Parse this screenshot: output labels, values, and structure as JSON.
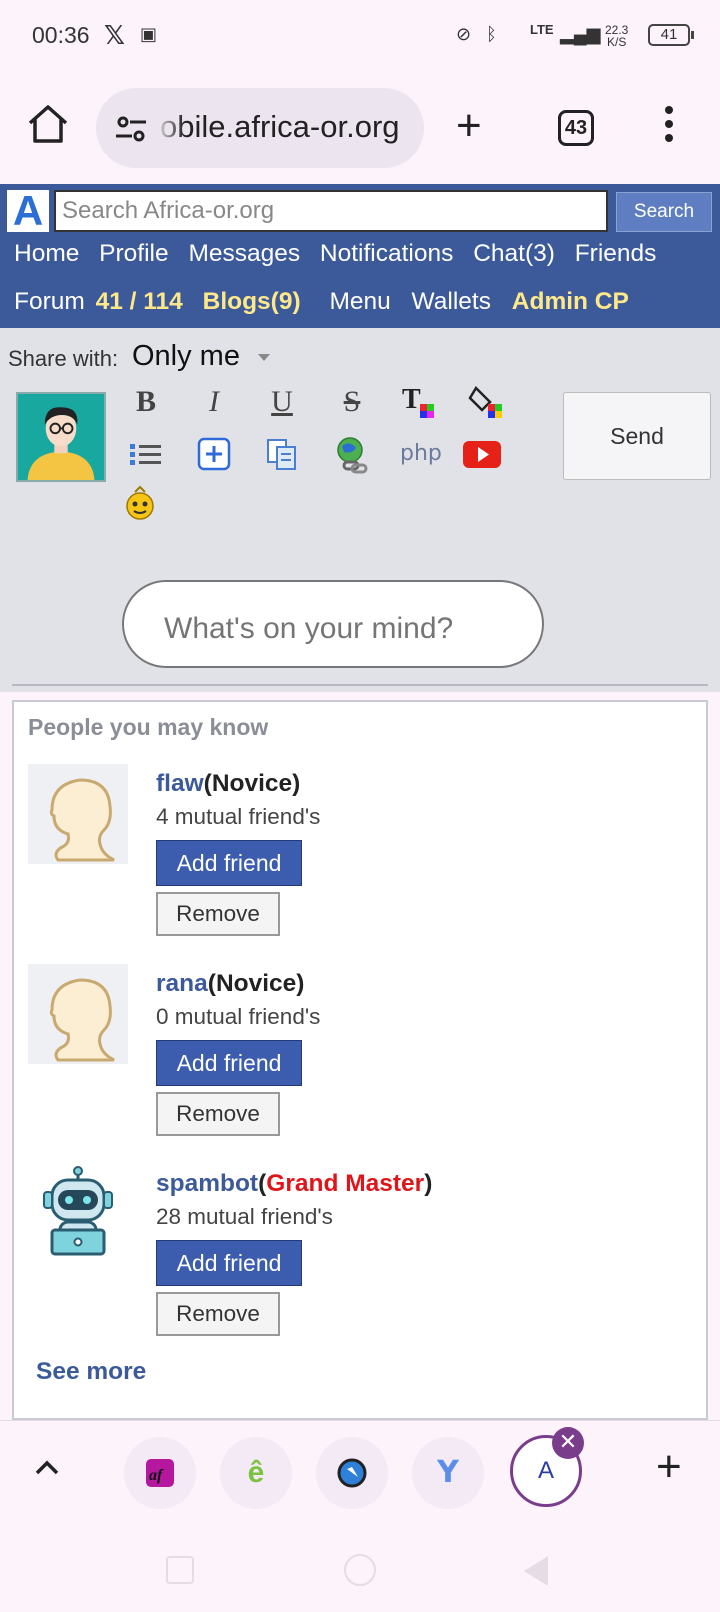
{
  "status_bar": {
    "time": "00:36",
    "x_icon": "x-logo-icon",
    "network_type": "LTE",
    "speed_value": "22.3",
    "speed_unit": "K/S",
    "battery": "41"
  },
  "browser": {
    "url": "obile.africa-or.org",
    "tab_count": "43",
    "new_tab_label": "+"
  },
  "site": {
    "logo": "A",
    "search_placeholder": "Search Africa-or.org",
    "search_button": "Search",
    "nav_row1": [
      "Home",
      "Profile",
      "Messages",
      "Notifications",
      "Chat(3)",
      "Friends"
    ],
    "nav_row2": {
      "forum": "Forum",
      "forum_count": "41 / 114",
      "blogs": "Blogs(9)",
      "menu": "Menu",
      "wallets": "Wallets",
      "admin": "Admin CP"
    },
    "highlight_color": "#ffe88a",
    "header_color": "#3c5a9a"
  },
  "composer": {
    "share_label": "Share with:",
    "share_value": "Only me",
    "send_button": "Send",
    "placeholder": "What's on your mind?",
    "toolbar_icons": [
      "bold-icon",
      "italic-icon",
      "underline-icon",
      "strikethrough-icon",
      "text-color-icon",
      "fill-color-icon",
      "list-icon",
      "insert-icon",
      "copy-icon",
      "link-icon",
      "php-icon",
      "youtube-icon",
      "emoji-icon"
    ]
  },
  "pymk": {
    "title": "People you may know",
    "people": [
      {
        "name": "flaw",
        "rank": "Novice",
        "mutual": "4 mutual friend's",
        "add": "Add friend",
        "remove": "Remove"
      },
      {
        "name": "rana",
        "rank": "Novice",
        "mutual": "0 mutual friend's",
        "add": "Add friend",
        "remove": "Remove"
      },
      {
        "name": "spambot",
        "rank": "Grand Master",
        "mutual": "28 mutual friend's",
        "add": "Add friend",
        "remove": "Remove"
      }
    ],
    "see_more": "See more"
  },
  "tab_strip": {
    "active_tab_letter": "A",
    "close_symbol": "✕",
    "new_tab_symbol": "+"
  }
}
